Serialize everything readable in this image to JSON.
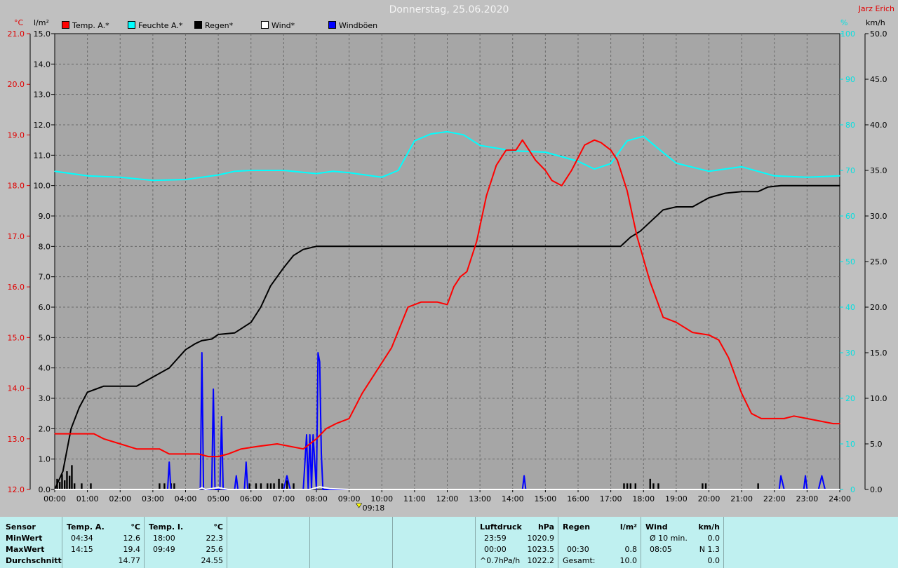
{
  "header": {
    "title": "Donnerstag, 25.06.2020",
    "author": "Jarz Erich"
  },
  "legend": [
    {
      "label": "Temp. A.*",
      "color": "#ff0000"
    },
    {
      "label": "Feuchte A.*",
      "color": "#00ffff"
    },
    {
      "label": "Regen*",
      "color": "#000000"
    },
    {
      "label": "Wind*",
      "color": "#ffffff"
    },
    {
      "label": "Windböen",
      "color": "#0000ff"
    }
  ],
  "units": {
    "temp": "°C",
    "rain": "l/m²",
    "humidity": "%",
    "wind": "km/h"
  },
  "chart_data": {
    "type": "line",
    "title": "Donnerstag, 25.06.2020",
    "x_ticks": [
      "00:00",
      "01:00",
      "02:00",
      "03:00",
      "04:00",
      "05:00",
      "06:00",
      "07:00",
      "08:00",
      "09:00",
      "10:00",
      "11:00",
      "12:00",
      "13:00",
      "14:00",
      "15:00",
      "16:00",
      "17:00",
      "18:00",
      "19:00",
      "20:00",
      "21:00",
      "22:00",
      "23:00",
      "24:00"
    ],
    "xlim": [
      0,
      24
    ],
    "x_marker": {
      "time": 9.3,
      "label": "09:18"
    },
    "axes": {
      "temp": {
        "label": "°C",
        "range": [
          12.0,
          21.0
        ],
        "ticks": [
          "12.0",
          "13.0",
          "14.0",
          "15.0",
          "16.0",
          "17.0",
          "18.0",
          "19.0",
          "20.0",
          "21.0"
        ]
      },
      "rain": {
        "label": "l/m²",
        "range": [
          0.0,
          15.0
        ],
        "ticks": [
          "0.0",
          "1.0",
          "2.0",
          "3.0",
          "4.0",
          "5.0",
          "6.0",
          "7.0",
          "8.0",
          "9.0",
          "10.0",
          "11.0",
          "12.0",
          "13.0",
          "14.0",
          "15.0"
        ]
      },
      "humidity": {
        "label": "%",
        "range": [
          0,
          100
        ],
        "ticks": [
          "0",
          "10",
          "20",
          "30",
          "40",
          "50",
          "60",
          "70",
          "80",
          "90",
          "100"
        ]
      },
      "wind": {
        "label": "km/h",
        "range": [
          0.0,
          50.0
        ],
        "ticks": [
          "0.0",
          "5.0",
          "10.0",
          "15.0",
          "20.0",
          "25.0",
          "30.0",
          "35.0",
          "40.0",
          "45.0",
          "50.0"
        ]
      }
    },
    "grid": true,
    "series": [
      {
        "name": "Temp. A.*",
        "axis": "temp",
        "color": "#ff0000",
        "x": [
          0,
          1.2,
          1.5,
          2,
          2.5,
          3.2,
          3.5,
          4,
          4.4,
          4.7,
          5,
          5.3,
          5.7,
          6.2,
          6.8,
          7.2,
          7.6,
          8,
          8.3,
          8.6,
          9,
          9.4,
          9.8,
          10.3,
          10.8,
          11.2,
          11.4,
          11.7,
          12,
          12.2,
          12.4,
          12.6,
          12.9,
          13.2,
          13.5,
          13.8,
          14.1,
          14.3,
          14.5,
          14.7,
          15,
          15.2,
          15.5,
          15.8,
          16.2,
          16.5,
          16.7,
          17,
          17.2,
          17.5,
          17.8,
          18.2,
          18.6,
          19,
          19.5,
          20,
          20.3,
          20.6,
          21,
          21.3,
          21.6,
          22,
          22.3,
          22.6,
          23,
          23.4,
          23.8,
          24
        ],
        "y": [
          13.1,
          13.1,
          13.0,
          12.9,
          12.8,
          12.8,
          12.7,
          12.7,
          12.7,
          12.65,
          12.65,
          12.7,
          12.8,
          12.85,
          12.9,
          12.85,
          12.8,
          13.0,
          13.2,
          13.3,
          13.4,
          13.9,
          14.3,
          14.8,
          15.6,
          15.7,
          15.7,
          15.7,
          15.65,
          16.0,
          16.2,
          16.3,
          16.9,
          17.8,
          18.4,
          18.7,
          18.7,
          18.9,
          18.7,
          18.5,
          18.3,
          18.1,
          18.0,
          18.3,
          18.8,
          18.9,
          18.85,
          18.7,
          18.5,
          17.9,
          17.0,
          16.1,
          15.4,
          15.3,
          15.1,
          15.05,
          14.95,
          14.6,
          13.9,
          13.5,
          13.4,
          13.4,
          13.4,
          13.45,
          13.4,
          13.35,
          13.3,
          13.3
        ]
      },
      {
        "name": "Feuchte A.*",
        "axis": "humidity",
        "color": "#00ffff",
        "x": [
          0,
          1,
          2,
          3,
          4,
          4.5,
          5,
          5.5,
          6,
          7,
          8,
          8.5,
          9,
          10,
          10.5,
          11,
          11.5,
          12,
          12.5,
          13,
          14,
          15,
          16,
          16.5,
          17,
          17.5,
          18,
          18.5,
          19,
          20,
          21,
          22,
          23,
          24
        ],
        "y": [
          69.8,
          68.8,
          68.5,
          67.8,
          68,
          68.5,
          69,
          69.8,
          70,
          70,
          69.3,
          69.8,
          69.5,
          68.5,
          70,
          76.5,
          78,
          78.5,
          77.8,
          75.5,
          74.3,
          74,
          72,
          70.3,
          71.5,
          76.5,
          77.5,
          74.5,
          71.6,
          69.8,
          70.8,
          68.8,
          68.5,
          68.8
        ]
      },
      {
        "name": "Regen*",
        "axis": "rain",
        "color": "#000000",
        "x": [
          0,
          0.25,
          0.5,
          0.75,
          1,
          1.25,
          1.5,
          2,
          2.5,
          3,
          3.5,
          4,
          4.3,
          4.5,
          4.8,
          5,
          5.5,
          6,
          6.3,
          6.6,
          7,
          7.3,
          7.6,
          8,
          8.3,
          8.6,
          9,
          10,
          12,
          14,
          16,
          17.3,
          17.6,
          17.9,
          18.2,
          18.6,
          19,
          19.5,
          20,
          20.5,
          21,
          21.5,
          21.8,
          22.2,
          22.6,
          24
        ],
        "y": [
          0,
          0.6,
          2,
          2.7,
          3.2,
          3.3,
          3.4,
          3.4,
          3.4,
          3.7,
          4.0,
          4.6,
          4.8,
          4.9,
          4.95,
          5.1,
          5.15,
          5.5,
          6.0,
          6.7,
          7.3,
          7.7,
          7.9,
          8.0,
          8.0,
          8.0,
          8.0,
          8.0,
          8.0,
          8.0,
          8.0,
          8.0,
          8.3,
          8.5,
          8.8,
          9.2,
          9.3,
          9.3,
          9.6,
          9.75,
          9.8,
          9.8,
          9.95,
          10.0,
          10.0,
          10.0
        ]
      },
      {
        "name": "Windböen",
        "axis": "wind",
        "color": "#0000ff",
        "x": [
          0,
          3.45,
          3.5,
          3.55,
          4.45,
          4.5,
          4.55,
          4.6,
          4.7,
          4.8,
          4.85,
          4.9,
          5.05,
          5.1,
          5.15,
          5.5,
          5.55,
          5.6,
          5.8,
          5.85,
          5.9,
          7,
          7.1,
          7.2,
          7.6,
          7.7,
          7.75,
          7.8,
          7.85,
          7.9,
          8,
          8.05,
          8.1,
          8.15,
          8.2,
          8.25,
          8.3,
          14.3,
          14.35,
          14.4,
          21.9,
          22.15,
          22.2,
          22.3,
          22.9,
          22.95,
          23,
          23.35,
          23.45,
          23.55,
          24
        ],
        "y": [
          0,
          0,
          3,
          0,
          0,
          15,
          0,
          0,
          0,
          0,
          11,
          0,
          0,
          8,
          0,
          0,
          1.5,
          0,
          0,
          3,
          0,
          0,
          1.5,
          0,
          0,
          6,
          0,
          6,
          0,
          6,
          0,
          15,
          14,
          4,
          0,
          0,
          0,
          0,
          1.5,
          0,
          0,
          0,
          1.5,
          0,
          0,
          1.5,
          0,
          0,
          1.5,
          0,
          0
        ]
      },
      {
        "name": "Wind*",
        "axis": "wind",
        "color": "#ffffff",
        "x": [
          0,
          4.4,
          4.5,
          4.6,
          5,
          5.3,
          7.8,
          8.1,
          8.4,
          9,
          24
        ],
        "y": [
          0,
          0,
          0.2,
          0,
          0.2,
          0,
          0,
          0.3,
          0.1,
          0,
          0
        ]
      }
    ],
    "rain_bars": {
      "axis": "rain",
      "color": "#000000",
      "x": [
        0.07,
        0.15,
        0.22,
        0.3,
        0.37,
        0.45,
        0.52,
        0.6,
        0.82,
        1.1,
        3.2,
        3.35,
        3.55,
        3.65,
        5.95,
        6.15,
        6.3,
        6.5,
        6.6,
        6.7,
        6.85,
        6.95,
        7.1,
        7.3,
        17.4,
        17.5,
        17.6,
        17.75,
        18.2,
        18.3,
        18.45,
        19.8,
        19.9,
        21.5
      ],
      "values": [
        0.35,
        0.25,
        0.5,
        0.3,
        0.6,
        0.45,
        0.8,
        0.2,
        0.2,
        0.2,
        0.2,
        0.2,
        0.2,
        0.2,
        0.2,
        0.2,
        0.2,
        0.2,
        0.2,
        0.2,
        0.35,
        0.2,
        0.3,
        0.2,
        0.2,
        0.2,
        0.2,
        0.2,
        0.35,
        0.2,
        0.2,
        0.2,
        0.2,
        0.2
      ]
    }
  },
  "stats": {
    "sensor": {
      "header": "Sensor",
      "rows": [
        "MinWert",
        "MaxWert",
        "Durchschnitt"
      ]
    },
    "temp_a": {
      "header": "Temp. A.",
      "unit": "°C",
      "rows": [
        [
          "04:34",
          "12.6"
        ],
        [
          "14:15",
          "19.4"
        ],
        [
          "",
          "14.77"
        ]
      ]
    },
    "temp_i": {
      "header": "Temp. I.",
      "unit": "°C",
      "rows": [
        [
          "18:00",
          "22.3"
        ],
        [
          "09:49",
          "25.6"
        ],
        [
          "",
          "24.55"
        ]
      ]
    },
    "pressure": {
      "header": "Luftdruck",
      "unit": "hPa",
      "rows": [
        [
          "23:59",
          "1020.9"
        ],
        [
          "00:00",
          "1023.5"
        ],
        [
          "^0.7hPa/h",
          "1022.2"
        ]
      ]
    },
    "rain": {
      "header": "Regen",
      "unit": "l/m²",
      "rows": [
        [
          "",
          ""
        ],
        [
          "00:30",
          "0.8"
        ],
        [
          "Gesamt:",
          "10.0"
        ]
      ]
    },
    "wind": {
      "header": "Wind",
      "unit": "km/h",
      "rows": [
        [
          "Ø 10 min.",
          "0.0"
        ],
        [
          "08:05",
          "N 1.3"
        ],
        [
          "",
          "0.0"
        ]
      ]
    }
  }
}
